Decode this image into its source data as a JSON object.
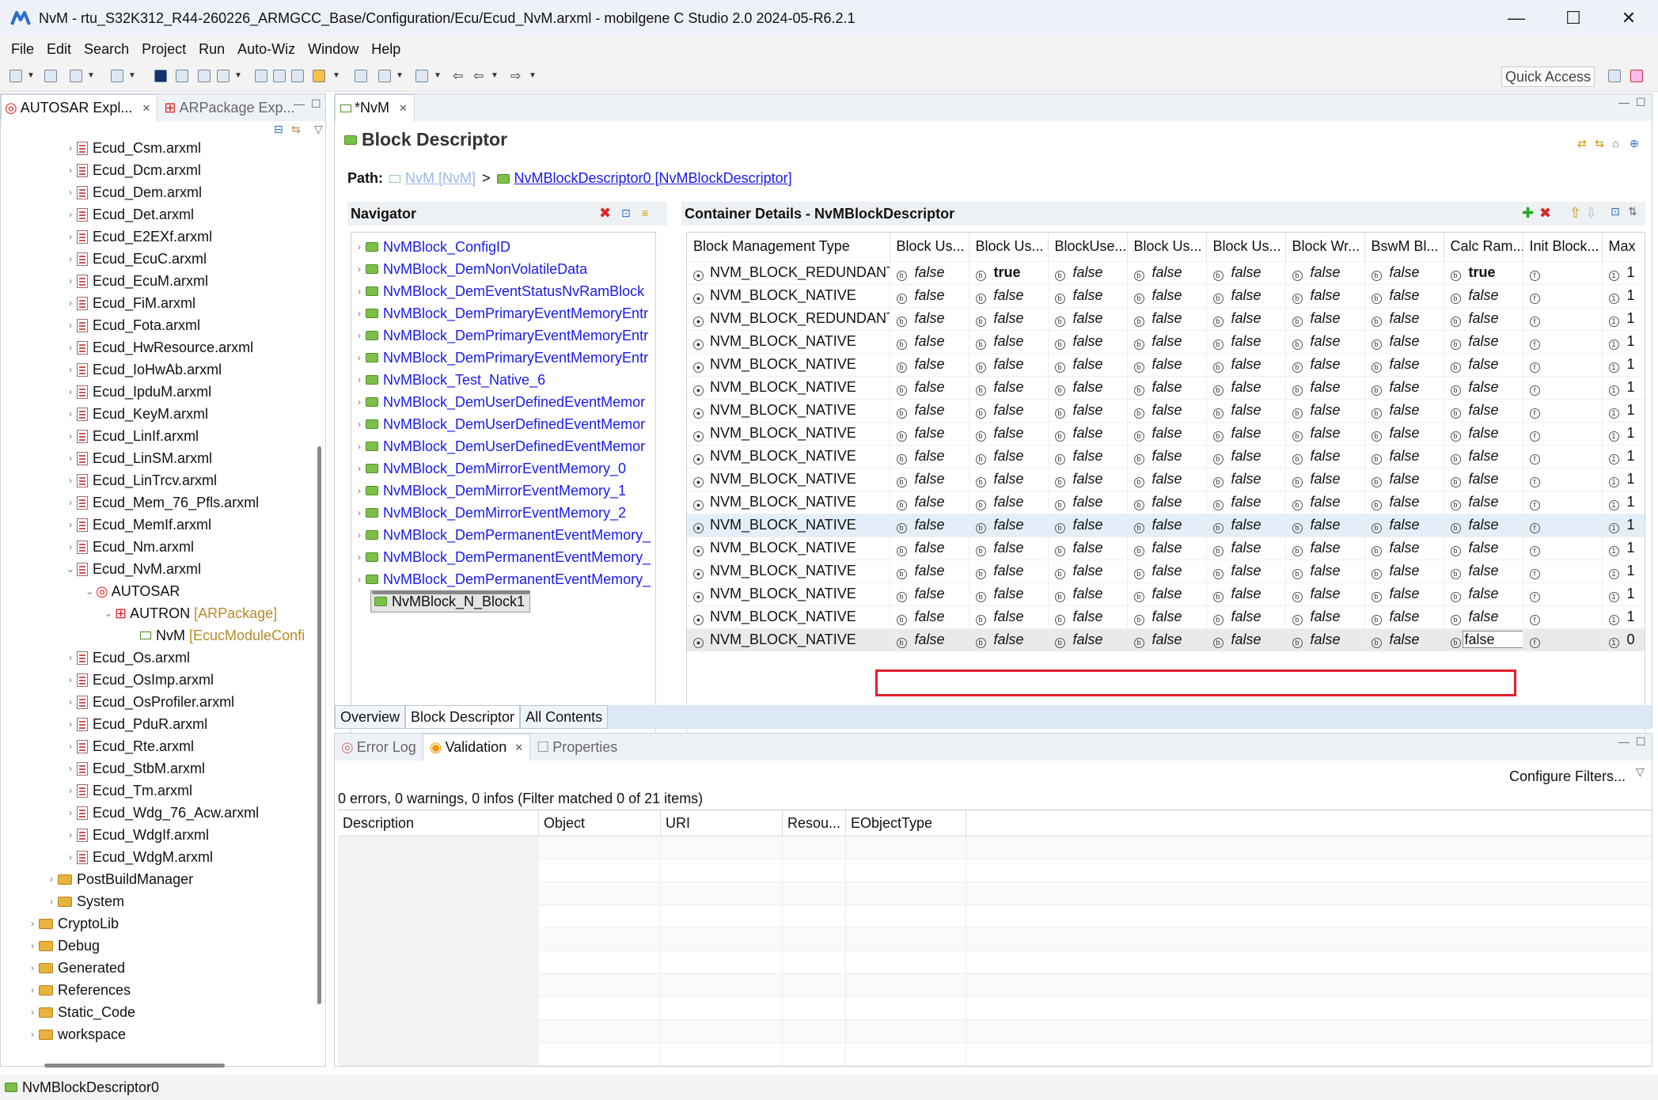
{
  "window": {
    "title": "NvM - rtu_S32K312_R44-260226_ARMGCC_Base/Configuration/Ecu/Ecud_NvM.arxml - mobilgene C Studio 2.0 2024-05-R6.2.1",
    "minimize": "—",
    "maximize": "☐",
    "close": "✕"
  },
  "menu": [
    "File",
    "Edit",
    "Search",
    "Project",
    "Run",
    "Auto-Wiz",
    "Window",
    "Help"
  ],
  "toolbar": {
    "quick_access": "Quick Access"
  },
  "explorer": {
    "tabs": [
      {
        "label": "AUTOSAR Expl..."
      },
      {
        "label": "ARPackage Exp..."
      }
    ],
    "files": [
      "Ecud_Csm.arxml",
      "Ecud_Dcm.arxml",
      "Ecud_Dem.arxml",
      "Ecud_Det.arxml",
      "Ecud_E2EXf.arxml",
      "Ecud_EcuC.arxml",
      "Ecud_EcuM.arxml",
      "Ecud_FiM.arxml",
      "Ecud_Fota.arxml",
      "Ecud_HwResource.arxml",
      "Ecud_IoHwAb.arxml",
      "Ecud_IpduM.arxml",
      "Ecud_KeyM.arxml",
      "Ecud_LinIf.arxml",
      "Ecud_LinSM.arxml",
      "Ecud_LinTrcv.arxml",
      "Ecud_Mem_76_Pfls.arxml",
      "Ecud_MemIf.arxml",
      "Ecud_Nm.arxml",
      "Ecud_NvM.arxml"
    ],
    "nvm_children": {
      "autosar": "AUTOSAR",
      "autron": "AUTRON",
      "autron_type": "[ARPackage]",
      "nvm": "NvM",
      "nvm_type": "[EcucModuleConfi"
    },
    "files2": [
      "Ecud_Os.arxml",
      "Ecud_OsImp.arxml",
      "Ecud_OsProfiler.arxml",
      "Ecud_PduR.arxml",
      "Ecud_Rte.arxml",
      "Ecud_StbM.arxml",
      "Ecud_Tm.arxml",
      "Ecud_Wdg_76_Acw.arxml",
      "Ecud_WdgIf.arxml",
      "Ecud_WdgM.arxml"
    ],
    "folders_l2": [
      "PostBuildManager",
      "System"
    ],
    "folders_l1": [
      "CryptoLib",
      "Debug",
      "Generated",
      "References",
      "Static_Code",
      "workspace"
    ]
  },
  "editor": {
    "tab": "*NvM",
    "title": "Block Descriptor",
    "path_label": "Path:",
    "path_root": "NvM [NvM]",
    "path_sep": ">",
    "path_leaf": "NvMBlockDescriptor0 [NvMBlockDescriptor]",
    "navigator": {
      "title": "Navigator",
      "items": [
        "NvMBlock_ConfigID",
        "NvMBlock_DemNonVolatileData",
        "NvMBlock_DemEventStatusNvRamBlock",
        "NvMBlock_DemPrimaryEventMemoryEntr",
        "NvMBlock_DemPrimaryEventMemoryEntr",
        "NvMBlock_DemPrimaryEventMemoryEntr",
        "NvMBlock_Test_Native_6",
        "NvMBlock_DemUserDefinedEventMemor",
        "NvMBlock_DemUserDefinedEventMemor",
        "NvMBlock_DemUserDefinedEventMemor",
        "NvMBlock_DemMirrorEventMemory_0",
        "NvMBlock_DemMirrorEventMemory_1",
        "NvMBlock_DemMirrorEventMemory_2",
        "NvMBlock_DemPermanentEventMemory_",
        "NvMBlock_DemPermanentEventMemory_",
        "NvMBlock_DemPermanentEventMemory_"
      ],
      "selected": "NvMBlock_N_Block1"
    },
    "details": {
      "title": "Container Details - NvMBlockDescriptor",
      "columns": [
        "Block Management Type",
        "Block Us...",
        "Block Us...",
        "BlockUse...",
        "Block Us...",
        "Block Us...",
        "Block Wr...",
        "BswM Bl...",
        "Calc Ram...",
        "Init Block...",
        "Max"
      ],
      "rows": [
        [
          "NVM_BLOCK_REDUNDANT",
          "false",
          "true",
          "false",
          "false",
          "false",
          "false",
          "false",
          "true",
          "",
          "1"
        ],
        [
          "NVM_BLOCK_NATIVE",
          "false",
          "false",
          "false",
          "false",
          "false",
          "false",
          "false",
          "false",
          "",
          "1"
        ],
        [
          "NVM_BLOCK_REDUNDANT",
          "false",
          "false",
          "false",
          "false",
          "false",
          "false",
          "false",
          "false",
          "",
          "1"
        ],
        [
          "NVM_BLOCK_NATIVE",
          "false",
          "false",
          "false",
          "false",
          "false",
          "false",
          "false",
          "false",
          "",
          "1"
        ],
        [
          "NVM_BLOCK_NATIVE",
          "false",
          "false",
          "false",
          "false",
          "false",
          "false",
          "false",
          "false",
          "",
          "1"
        ],
        [
          "NVM_BLOCK_NATIVE",
          "false",
          "false",
          "false",
          "false",
          "false",
          "false",
          "false",
          "false",
          "",
          "1"
        ],
        [
          "NVM_BLOCK_NATIVE",
          "false",
          "false",
          "false",
          "false",
          "false",
          "false",
          "false",
          "false",
          "",
          "1"
        ],
        [
          "NVM_BLOCK_NATIVE",
          "false",
          "false",
          "false",
          "false",
          "false",
          "false",
          "false",
          "false",
          "",
          "1"
        ],
        [
          "NVM_BLOCK_NATIVE",
          "false",
          "false",
          "false",
          "false",
          "false",
          "false",
          "false",
          "false",
          "",
          "1"
        ],
        [
          "NVM_BLOCK_NATIVE",
          "false",
          "false",
          "false",
          "false",
          "false",
          "false",
          "false",
          "false",
          "",
          "1"
        ],
        [
          "NVM_BLOCK_NATIVE",
          "false",
          "false",
          "false",
          "false",
          "false",
          "false",
          "false",
          "false",
          "",
          "1"
        ],
        [
          "NVM_BLOCK_NATIVE",
          "false",
          "false",
          "false",
          "false",
          "false",
          "false",
          "false",
          "false",
          "",
          "1"
        ],
        [
          "NVM_BLOCK_NATIVE",
          "false",
          "false",
          "false",
          "false",
          "false",
          "false",
          "false",
          "false",
          "",
          "1"
        ],
        [
          "NVM_BLOCK_NATIVE",
          "false",
          "false",
          "false",
          "false",
          "false",
          "false",
          "false",
          "false",
          "",
          "1"
        ],
        [
          "NVM_BLOCK_NATIVE",
          "false",
          "false",
          "false",
          "false",
          "false",
          "false",
          "false",
          "false",
          "",
          "1"
        ],
        [
          "NVM_BLOCK_NATIVE",
          "false",
          "false",
          "false",
          "false",
          "false",
          "false",
          "false",
          "false",
          "",
          "1"
        ],
        [
          "NVM_BLOCK_NATIVE",
          "false",
          "false",
          "false",
          "false",
          "false",
          "false",
          "false",
          "false",
          "",
          "0"
        ]
      ]
    },
    "bottom_tabs": [
      "Overview",
      "Block Descriptor",
      "All Contents"
    ]
  },
  "bottom": {
    "tabs": [
      "Error Log",
      "Validation",
      "Properties"
    ],
    "configure": "Configure Filters...",
    "summary": "0 errors, 0 warnings, 0 infos (Filter matched 0 of 21 items)",
    "columns": [
      "Description",
      "Object",
      "URI",
      "Resou...",
      "EObjectType"
    ]
  },
  "status": {
    "text": "NvMBlockDescriptor0"
  },
  "colors": {
    "accent": "#1a1aee",
    "highlight": "#e41e2b"
  }
}
